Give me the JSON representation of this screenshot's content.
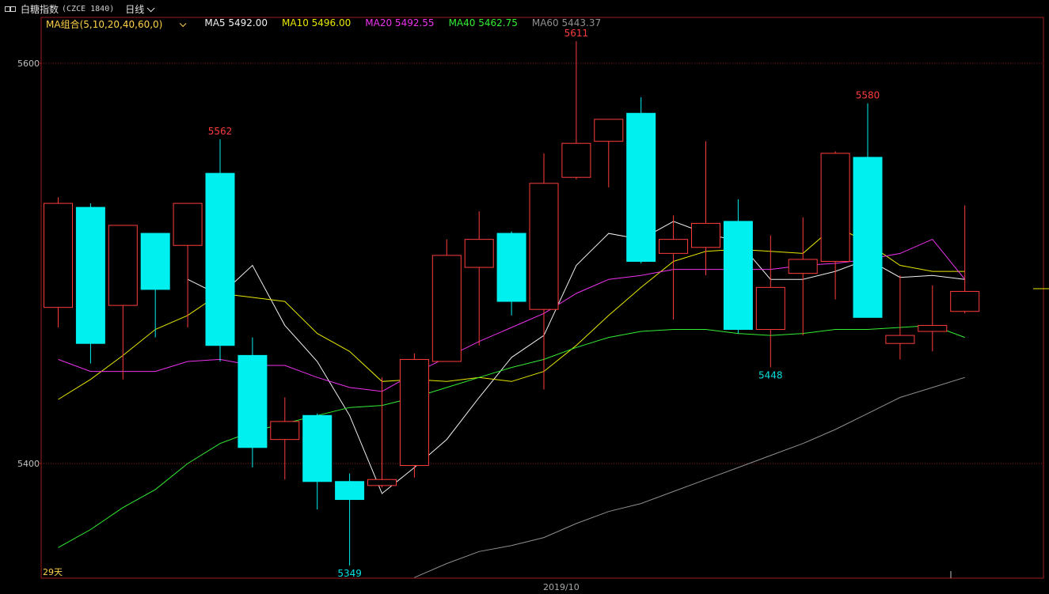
{
  "header": {
    "name": "白糖指数",
    "code": "(CZCE 1840)",
    "period": "日线"
  },
  "ma_legend": {
    "combo": "MA组合(5,10,20,40,60,0)",
    "items": [
      {
        "label": "MA5 5492.00",
        "color": "#f0f0f0"
      },
      {
        "label": "MA10 5496.00",
        "color": "#e8e800"
      },
      {
        "label": "MA20 5492.55",
        "color": "#ee33ee"
      },
      {
        "label": "MA40 5462.75",
        "color": "#33ee33"
      },
      {
        "label": "MA60 5443.37",
        "color": "#909090"
      }
    ]
  },
  "footer": {
    "days": "29天",
    "date": "2019/10"
  },
  "colors": {
    "up": "#ff3c3c",
    "down": "#00f0f0",
    "grid": "#8b1a1a",
    "axis": "#a01c1c"
  },
  "chart_data": {
    "type": "candlestick",
    "ylim": [
      5343,
      5630
    ],
    "yticks": [
      5400,
      5600
    ],
    "annotations": [
      {
        "candle": 5,
        "value": 5562,
        "kind": "high"
      },
      {
        "candle": 16,
        "value": 5611,
        "kind": "high"
      },
      {
        "candle": 25,
        "value": 5580,
        "kind": "high"
      },
      {
        "candle": 22,
        "value": 5448,
        "kind": "low"
      },
      {
        "candle": 9,
        "value": 5349,
        "kind": "low"
      }
    ],
    "candles": [
      {
        "o": 5478,
        "h": 5533,
        "l": 5468,
        "c": 5530
      },
      {
        "o": 5528,
        "h": 5530,
        "l": 5450,
        "c": 5460
      },
      {
        "o": 5479,
        "h": 5517,
        "l": 5442,
        "c": 5519
      },
      {
        "o": 5515,
        "h": 5515,
        "l": 5463,
        "c": 5487
      },
      {
        "o": 5509,
        "h": 5525,
        "l": 5468,
        "c": 5530
      },
      {
        "o": 5545,
        "h": 5562,
        "l": 5451,
        "c": 5459
      },
      {
        "o": 5454,
        "h": 5463,
        "l": 5398,
        "c": 5408
      },
      {
        "o": 5412,
        "h": 5433,
        "l": 5392,
        "c": 5421
      },
      {
        "o": 5424,
        "h": 5425,
        "l": 5377,
        "c": 5391
      },
      {
        "o": 5391,
        "h": 5395,
        "l": 5349,
        "c": 5382
      },
      {
        "o": 5389,
        "h": 5443,
        "l": 5388,
        "c": 5392
      },
      {
        "o": 5399,
        "h": 5455,
        "l": 5393,
        "c": 5452
      },
      {
        "o": 5451,
        "h": 5512,
        "l": 5451,
        "c": 5504
      },
      {
        "o": 5498,
        "h": 5526,
        "l": 5459,
        "c": 5512
      },
      {
        "o": 5515,
        "h": 5516,
        "l": 5474,
        "c": 5481
      },
      {
        "o": 5477,
        "h": 5555,
        "l": 5437,
        "c": 5540
      },
      {
        "o": 5543,
        "h": 5611,
        "l": 5542,
        "c": 5560
      },
      {
        "o": 5561,
        "h": 5564,
        "l": 5538,
        "c": 5572
      },
      {
        "o": 5575,
        "h": 5583,
        "l": 5500,
        "c": 5501
      },
      {
        "o": 5505,
        "h": 5524,
        "l": 5472,
        "c": 5512
      },
      {
        "o": 5508,
        "h": 5561,
        "l": 5494,
        "c": 5520
      },
      {
        "o": 5521,
        "h": 5532,
        "l": 5465,
        "c": 5467
      },
      {
        "o": 5467,
        "h": 5514,
        "l": 5448,
        "c": 5488
      },
      {
        "o": 5495,
        "h": 5523,
        "l": 5464,
        "c": 5502
      },
      {
        "o": 5501,
        "h": 5556,
        "l": 5482,
        "c": 5555
      },
      {
        "o": 5553,
        "h": 5580,
        "l": 5473,
        "c": 5473
      },
      {
        "o": 5460,
        "h": 5494,
        "l": 5452,
        "c": 5464
      },
      {
        "o": 5466,
        "h": 5489,
        "l": 5456,
        "c": 5469
      },
      {
        "o": 5476,
        "h": 5529,
        "l": 5475,
        "c": 5486
      }
    ],
    "ma": [
      {
        "name": "MA5",
        "color": "#f0f0f0",
        "values": [
          null,
          null,
          null,
          null,
          5492,
          5484,
          5499,
          5469,
          5451,
          5424,
          5385,
          5398,
          5412,
          5433,
          5453,
          5464,
          5499,
          5515,
          5512,
          5521,
          5515,
          5511,
          5492,
          5492,
          5496,
          5502,
          5493,
          5494,
          5492
        ]
      },
      {
        "name": "MA10",
        "color": "#e8e800",
        "values": [
          5432,
          5442,
          5454,
          5467,
          5474,
          5485,
          5483,
          5481,
          5465,
          5456,
          5441,
          5442,
          5441,
          5443,
          5441,
          5446,
          5459,
          5474,
          5488,
          5501,
          5506,
          5507,
          5506,
          5505,
          5519,
          5510,
          5499,
          5496,
          5496
        ]
      },
      {
        "name": "MA20",
        "color": "#ee33ee",
        "values": [
          5452,
          5446,
          5446,
          5446,
          5451,
          5452,
          5449,
          5449,
          5443,
          5438,
          5436,
          5445,
          5453,
          5461,
          5468,
          5475,
          5485,
          5492,
          5494,
          5497,
          5497,
          5497,
          5497,
          5499,
          5500,
          5502,
          5505,
          5512,
          5492
        ]
      },
      {
        "name": "MA40",
        "color": "#33ee33",
        "values": [
          5358,
          5367,
          5378,
          5387,
          5400,
          5410,
          5416,
          5420,
          5424,
          5428,
          5429,
          5433,
          5438,
          5443,
          5448,
          5452,
          5458,
          5463,
          5466,
          5467,
          5467,
          5465,
          5464,
          5465,
          5467,
          5467,
          5468,
          5469,
          5463
        ]
      },
      {
        "name": "MA60",
        "color": "#909090",
        "values": [
          null,
          null,
          null,
          null,
          null,
          null,
          null,
          null,
          null,
          null,
          null,
          5343,
          5350,
          5356,
          5359,
          5363,
          5370,
          5376,
          5380,
          5386,
          5392,
          5398,
          5404,
          5410,
          5417,
          5425,
          5433,
          5438,
          5443
        ]
      }
    ]
  }
}
